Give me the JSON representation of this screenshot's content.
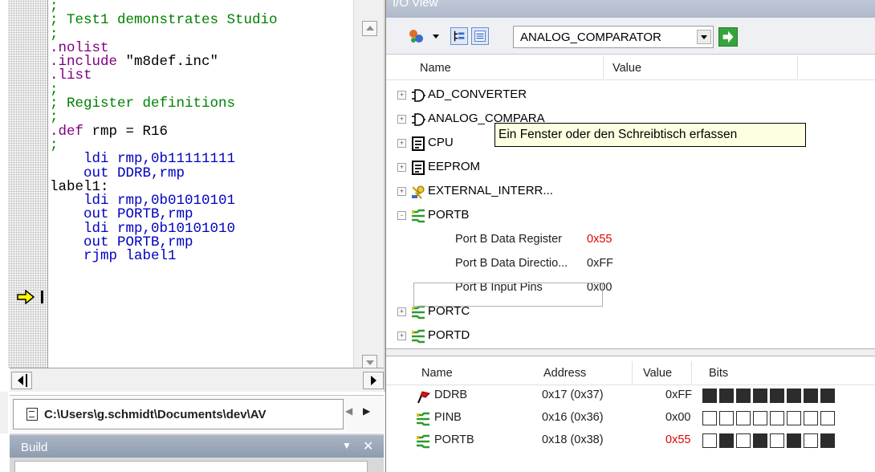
{
  "editor": {
    "code_lines": [
      {
        "text": ";",
        "kind": "comment"
      },
      {
        "text": "; Test1 demonstrates Studio",
        "kind": "comment"
      },
      {
        "text": ";",
        "kind": "comment"
      },
      {
        "text": ".nolist",
        "kind": "directive"
      },
      {
        "text": ".include \"m8def.inc\"",
        "kind": "directive"
      },
      {
        "text": ".list",
        "kind": "directive"
      },
      {
        "text": ";",
        "kind": "comment"
      },
      {
        "text": "; Register definitions",
        "kind": "comment"
      },
      {
        "text": ";",
        "kind": "comment"
      },
      {
        "text": ".def rmp = R16",
        "kind": "directive"
      },
      {
        "text": ";",
        "kind": "comment"
      },
      {
        "text": "    ldi rmp,0b11111111",
        "kind": "instr"
      },
      {
        "text": "    out DDRB,rmp",
        "kind": "instr"
      },
      {
        "text": "label1:",
        "kind": "label"
      },
      {
        "text": "    ldi rmp,0b01010101",
        "kind": "instr"
      },
      {
        "text": "    out PORTB,rmp",
        "kind": "instr"
      },
      {
        "text": "    ldi rmp,0b10101010",
        "kind": "instr"
      },
      {
        "text": "    out PORTB,rmp",
        "kind": "instr"
      },
      {
        "text": "    rjmp label1",
        "kind": "instr"
      }
    ],
    "execution_line_index": 16,
    "file_path": "C:\\Users\\g.schmidt\\Documents\\dev\\AV",
    "colors": {
      "comment": "#008000",
      "directive": "#800080",
      "keyword": "#0000c0",
      "arrow": "#ffff00"
    }
  },
  "build_panel": {
    "title": "Build",
    "pin_icon": "pin-dropdown-icon",
    "close_icon": "close-icon"
  },
  "io_view": {
    "title": "I/O View",
    "toolbar": {
      "selected_module": "ANALOG_COMPARATOR",
      "icons": [
        "filter-icon",
        "tree-view-icon",
        "list-view-icon",
        "go-arrow-icon"
      ]
    },
    "tree_header": {
      "name": "Name",
      "value": "Value"
    },
    "tree_items": [
      {
        "label": "AD_CONVERTER",
        "icon": "gate-icon",
        "expander": "+"
      },
      {
        "label": "ANALOG_COMPARA",
        "icon": "gate-icon",
        "expander": "+"
      },
      {
        "label": "CPU",
        "icon": "document-icon",
        "expander": "+"
      },
      {
        "label": "EEPROM",
        "icon": "document-icon",
        "expander": "+"
      },
      {
        "label": "EXTERNAL_INTERR...",
        "icon": "interrupt-icon",
        "expander": "+"
      },
      {
        "label": "PORTB",
        "icon": "port-icon",
        "expander": "-"
      }
    ],
    "portb_registers": [
      {
        "name": "Port B Data Register",
        "value": "0x55",
        "changed": true
      },
      {
        "name": "Port B Data Directio...",
        "value": "0xFF",
        "changed": false
      },
      {
        "name": "Port B Input Pins",
        "value": "0x00",
        "changed": false
      }
    ],
    "tree_items_after": [
      {
        "label": "PORTC",
        "icon": "port-icon",
        "expander": "+"
      },
      {
        "label": "PORTD",
        "icon": "port-icon",
        "expander": "+"
      }
    ],
    "tooltip": "Ein Fenster oder den Schreibtisch erfassen",
    "register_header": {
      "name": "Name",
      "address": "Address",
      "value": "Value",
      "bits": "Bits"
    },
    "registers": [
      {
        "name": "DDRB",
        "icon": "flag-icon",
        "address": "0x17 (0x37)",
        "value": "0xFF",
        "changed": false,
        "bits": [
          1,
          1,
          1,
          1,
          1,
          1,
          1,
          1
        ]
      },
      {
        "name": "PINB",
        "icon": "port-icon",
        "address": "0x16 (0x36)",
        "value": "0x00",
        "changed": false,
        "bits": [
          0,
          0,
          0,
          0,
          0,
          0,
          0,
          0
        ]
      },
      {
        "name": "PORTB",
        "icon": "port-icon",
        "address": "0x18 (0x38)",
        "value": "0x55",
        "changed": true,
        "bits": [
          0,
          1,
          0,
          1,
          0,
          1,
          0,
          1
        ]
      }
    ]
  }
}
